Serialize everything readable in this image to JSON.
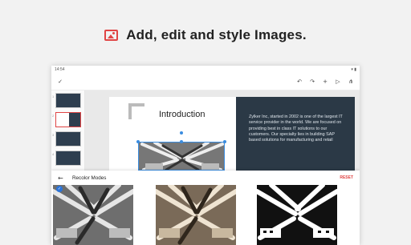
{
  "banner": {
    "title": "Add, edit and style Images.",
    "icon": "image-icon",
    "accent": "#e04545"
  },
  "status_bar": {
    "time": "14:54"
  },
  "toolbar": {
    "left_icon": "check-icon",
    "right_icons": [
      "undo-icon",
      "redo-icon",
      "add-icon",
      "play-icon",
      "share-icon"
    ]
  },
  "thumbnails": [
    {
      "number": "1",
      "selected": false
    },
    {
      "number": "2",
      "selected": true
    },
    {
      "number": "3",
      "selected": false
    },
    {
      "number": "4",
      "selected": false
    }
  ],
  "slide": {
    "title": "Introduction",
    "body": "Zylker Inc, started in 2002 is one of the largest IT service provider in the world. We are focused on providing best in class IT solutions to our customers. Our specialty lies in building SAP based solutions for manufacturing and retail"
  },
  "recolor": {
    "title": "Recolor Modes",
    "reset_label": "RESET",
    "modes": [
      {
        "name": "grayscale",
        "selected": true
      },
      {
        "name": "sepia",
        "selected": false
      },
      {
        "name": "black-and-white",
        "selected": false
      }
    ]
  },
  "colors": {
    "accent": "#e04545",
    "selection": "#3b8de0",
    "slide_dark": "#2b3946"
  }
}
